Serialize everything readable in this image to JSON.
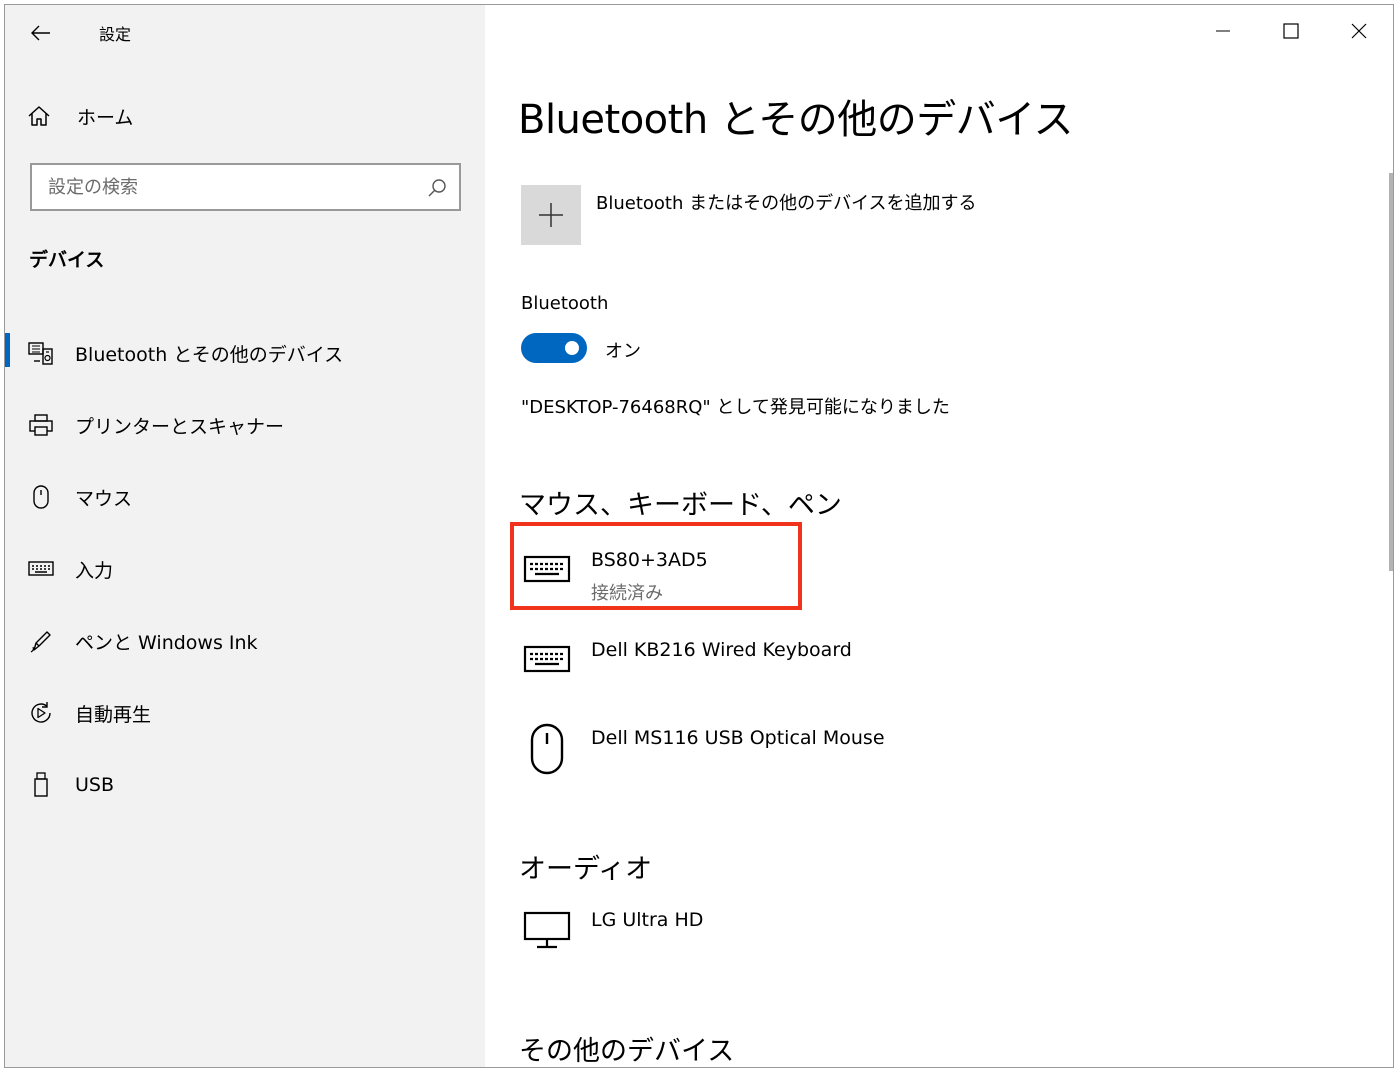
{
  "app": {
    "title": "設定"
  },
  "sidebar": {
    "home_label": "ホーム",
    "search_placeholder": "設定の検索",
    "section_title": "デバイス",
    "items": [
      {
        "label": "Bluetooth とその他のデバイス",
        "icon": "bluetooth-devices-icon",
        "active": true
      },
      {
        "label": "プリンターとスキャナー",
        "icon": "printer-icon",
        "active": false
      },
      {
        "label": "マウス",
        "icon": "mouse-icon",
        "active": false
      },
      {
        "label": "入力",
        "icon": "keyboard-icon",
        "active": false
      },
      {
        "label": "ペンと Windows Ink",
        "icon": "pen-icon",
        "active": false
      },
      {
        "label": "自動再生",
        "icon": "autoplay-icon",
        "active": false
      },
      {
        "label": "USB",
        "icon": "usb-icon",
        "active": false
      }
    ]
  },
  "main": {
    "title": "Bluetooth とその他のデバイス",
    "add_device_label": "Bluetooth またはその他のデバイスを追加する",
    "bluetooth_label": "Bluetooth",
    "bluetooth_state": "オン",
    "discoverable_text": "\"DESKTOP-76468RQ\" として発見可能になりました",
    "groups": {
      "input": {
        "title": "マウス、キーボード、ペン",
        "devices": [
          {
            "name": "BS80+3AD5",
            "status": "接続済み",
            "icon": "keyboard-icon"
          },
          {
            "name": "Dell KB216 Wired Keyboard",
            "status": "",
            "icon": "keyboard-icon"
          },
          {
            "name": "Dell MS116 USB Optical Mouse",
            "status": "",
            "icon": "mouse-icon"
          }
        ]
      },
      "audio": {
        "title": "オーディオ",
        "devices": [
          {
            "name": "LG Ultra HD",
            "status": "",
            "icon": "monitor-icon"
          }
        ]
      },
      "other": {
        "title": "その他のデバイス"
      }
    }
  },
  "colors": {
    "accent": "#0067c0",
    "highlight": "#f0331a",
    "sidebar_bg": "#f2f2f2"
  }
}
